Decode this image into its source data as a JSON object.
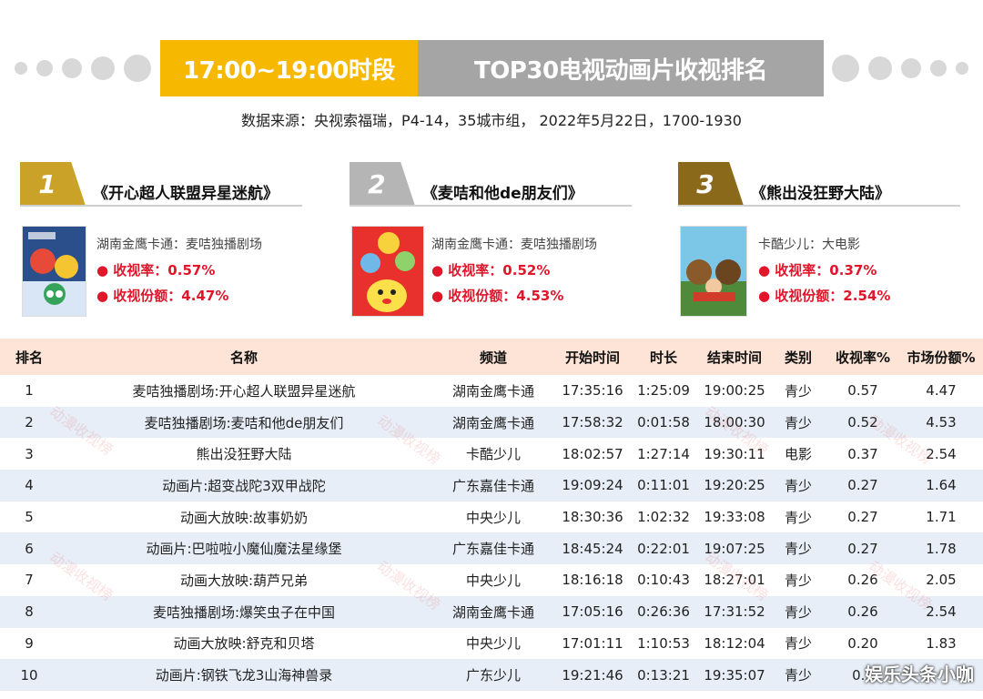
{
  "header": {
    "left_title": "17:00~19:00时段",
    "right_title": "TOP30电视动画片收视排名",
    "source": "数据来源：央视索福瑞，P4-14，35城市组， 2022年5月22日，1700-1930"
  },
  "colors": {
    "gold": "#f6b800",
    "gray": "#a5a5a5",
    "rank1": "#c9a227",
    "rank2": "#b5b5b5",
    "rank3": "#8a6a1a",
    "stat_red": "#e0162b",
    "table_head": "#fde4d6",
    "row_alt": "#e7eef7"
  },
  "top3": [
    {
      "rank": "1",
      "title": "《开心超人联盟异星迷航》",
      "channel": "湖南金鹰卡通：麦咭独播剧场",
      "rating": "● 收视率：0.57%",
      "share": "● 收视份额：4.47%",
      "poster_icon": "poster-image"
    },
    {
      "rank": "2",
      "title": "《麦咭和他de朋友们》",
      "channel": "湖南金鹰卡通：麦咭独播剧场",
      "rating": "● 收视率：0.52%",
      "share": "● 收视份额：4.53%",
      "poster_icon": "poster-image"
    },
    {
      "rank": "3",
      "title": "《熊出没狂野大陆》",
      "channel": "卡酷少儿：大电影",
      "rating": "● 收视率：0.37%",
      "share": "● 收视份额：2.54%",
      "poster_icon": "poster-image"
    }
  ],
  "table": {
    "headers": [
      "排名",
      "名称",
      "频道",
      "开始时间",
      "时长",
      "结束时间",
      "类别",
      "收视率%",
      "市场份额%"
    ],
    "rows": [
      [
        "1",
        "麦咭独播剧场:开心超人联盟异星迷航",
        "湖南金鹰卡通",
        "17:35:16",
        "1:25:09",
        "19:00:25",
        "青少",
        "0.57",
        "4.47"
      ],
      [
        "2",
        "麦咭独播剧场:麦咭和他de朋友们",
        "湖南金鹰卡通",
        "17:58:32",
        "0:01:58",
        "18:00:30",
        "青少",
        "0.52",
        "4.53"
      ],
      [
        "3",
        "熊出没狂野大陆",
        "卡酷少儿",
        "18:02:57",
        "1:27:14",
        "19:30:11",
        "电影",
        "0.37",
        "2.54"
      ],
      [
        "4",
        "动画片:超变战陀3双甲战陀",
        "广东嘉佳卡通",
        "19:09:24",
        "0:11:01",
        "19:20:25",
        "青少",
        "0.27",
        "1.64"
      ],
      [
        "5",
        "动画大放映:故事奶奶",
        "中央少儿",
        "18:30:36",
        "1:02:32",
        "19:33:08",
        "青少",
        "0.27",
        "1.71"
      ],
      [
        "6",
        "动画片:巴啦啦小魔仙魔法星缘堡",
        "广东嘉佳卡通",
        "18:45:24",
        "0:22:01",
        "19:07:25",
        "青少",
        "0.27",
        "1.78"
      ],
      [
        "7",
        "动画大放映:葫芦兄弟",
        "中央少儿",
        "18:16:18",
        "0:10:43",
        "18:27:01",
        "青少",
        "0.26",
        "2.05"
      ],
      [
        "8",
        "麦咭独播剧场:爆笑虫子在中国",
        "湖南金鹰卡通",
        "17:05:16",
        "0:26:36",
        "17:31:52",
        "青少",
        "0.26",
        "2.54"
      ],
      [
        "9",
        "动画大放映:舒克和贝塔",
        "中央少儿",
        "17:01:11",
        "1:10:53",
        "18:12:04",
        "青少",
        "0.20",
        "1.83"
      ],
      [
        "10",
        "动画片:钢铁飞龙3山海神兽录",
        "广东少儿",
        "19:21:46",
        "0:13:21",
        "19:35:07",
        "青少",
        "0.9",
        ""
      ]
    ]
  },
  "watermark": "动漫收视榜",
  "credit": "娱乐头条小咖"
}
